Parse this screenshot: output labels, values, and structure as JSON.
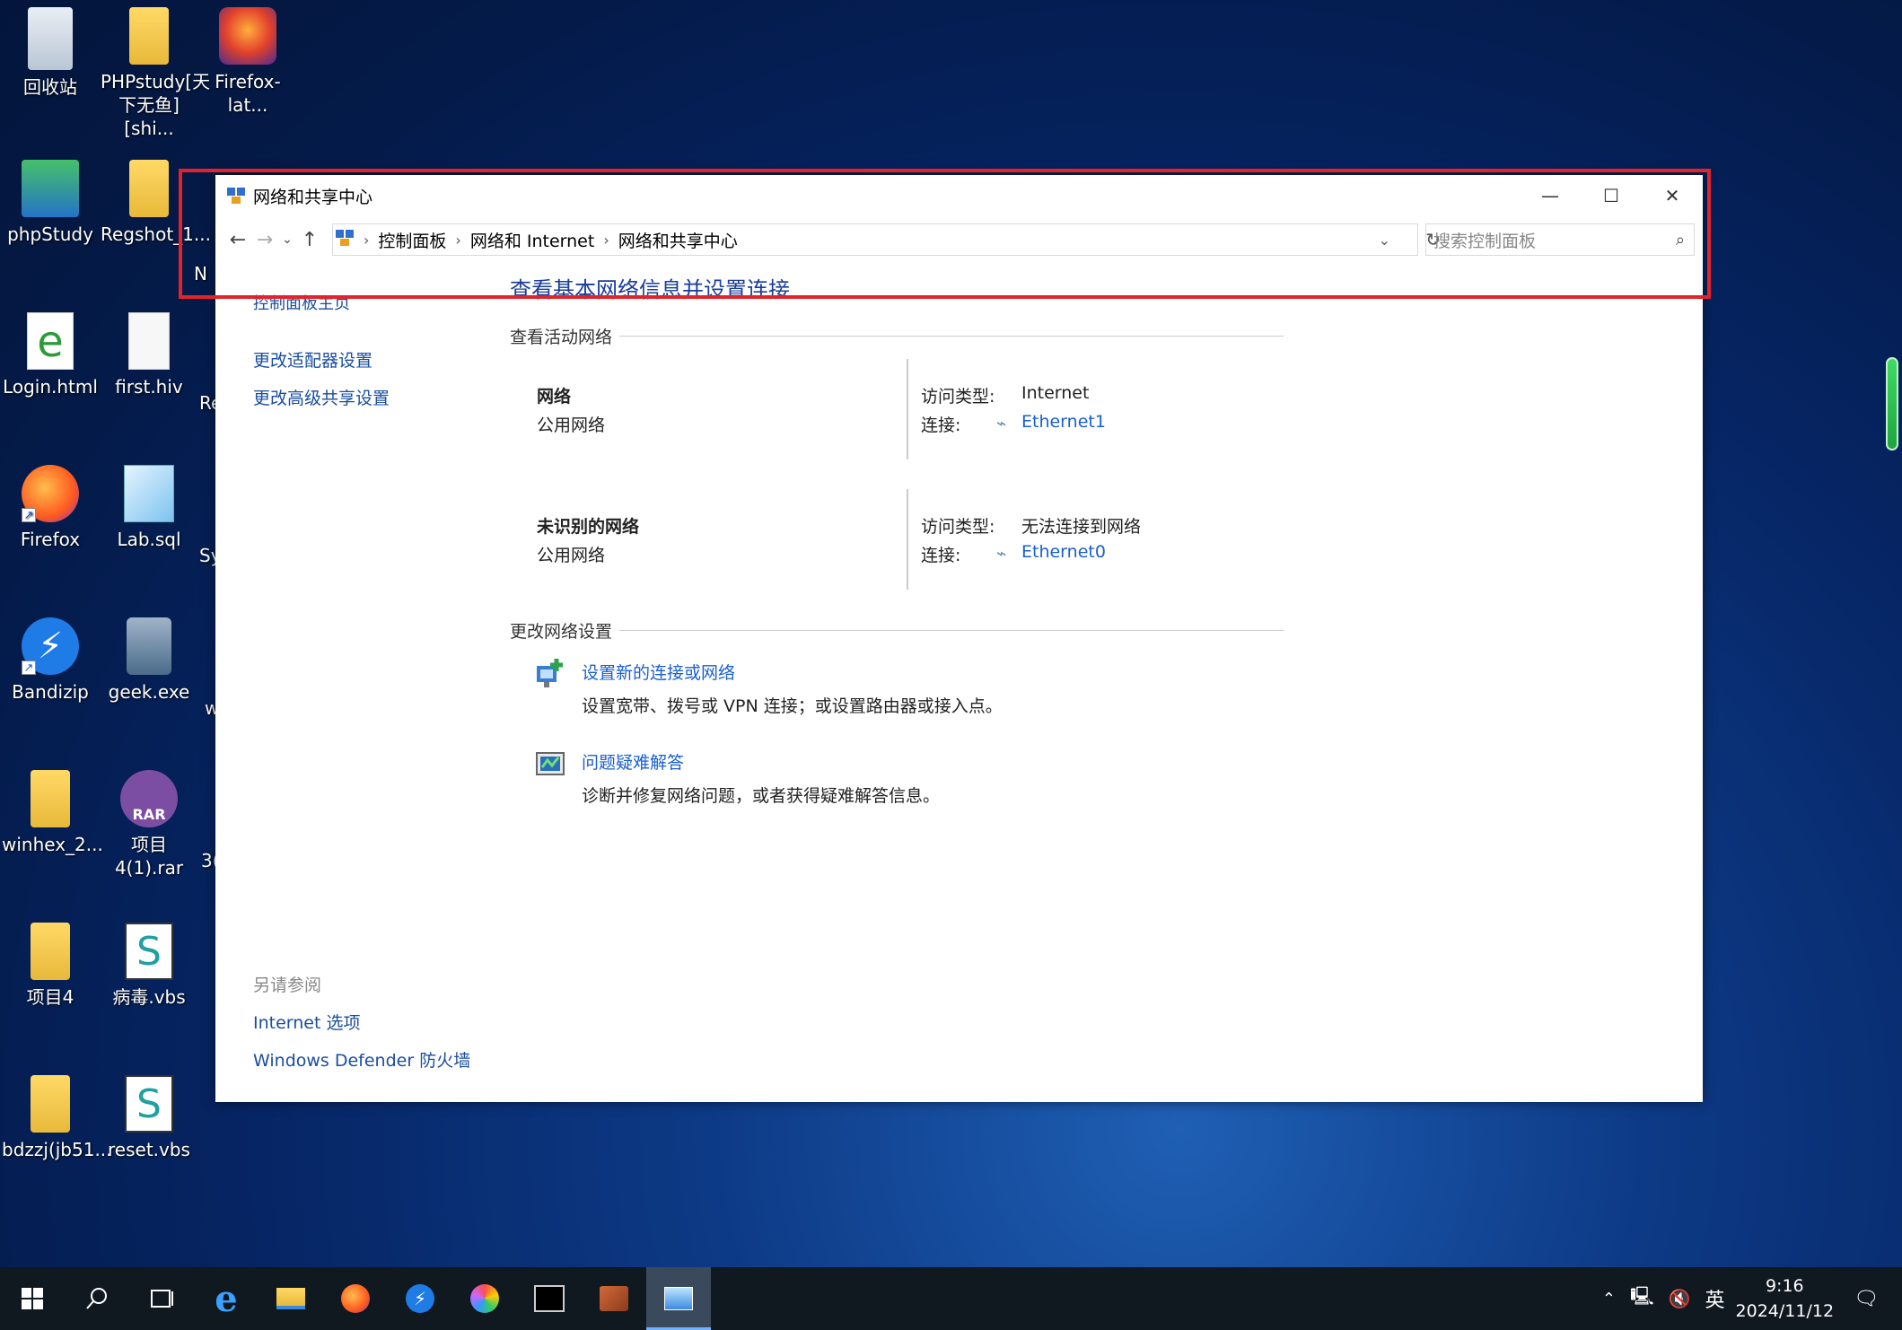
{
  "desktop": {
    "icons": [
      {
        "label": "回收站"
      },
      {
        "label": "PHPstudy[天\n下无鱼][shi..."
      },
      {
        "label": "Firefox-lat..."
      },
      {
        "label": "phpStudy"
      },
      {
        "label": "Regshot_1..."
      },
      {
        "label": "Login.html"
      },
      {
        "label": "first.hiv"
      },
      {
        "label": "Firefox"
      },
      {
        "label": "Lab.sql"
      },
      {
        "label": "Bandizip"
      },
      {
        "label": "geek.exe"
      },
      {
        "label": "winhex_2..."
      },
      {
        "label": "项目4(1).rar"
      },
      {
        "label": "项目4"
      },
      {
        "label": "病毒.vbs"
      },
      {
        "label": "bdzzj(jb51..."
      },
      {
        "label": "reset.vbs"
      }
    ],
    "partial_labels": [
      "N",
      "Re",
      "Sy",
      "w",
      "3("
    ]
  },
  "window": {
    "title": "网络和共享中心",
    "controls": {
      "minimize": "—",
      "maximize": "☐",
      "close": "✕"
    },
    "breadcrumbs": [
      "控制面板",
      "网络和 Internet",
      "网络和共享中心"
    ],
    "search_placeholder": "搜索控制面板",
    "left_nav": {
      "home": "控制面板主页",
      "adapter": "更改适配器设置",
      "sharing": "更改高级共享设置",
      "see_also_heading": "另请参阅",
      "internet_options": "Internet 选项",
      "firewall": "Windows Defender 防火墙"
    },
    "main_title": "查看基本网络信息并设置连接",
    "active_networks_heading": "查看活动网络",
    "networks": [
      {
        "name": "网络",
        "type": "公用网络",
        "access_label": "访问类型:",
        "access": "Internet",
        "conn_label": "连接:",
        "conn": "Ethernet1"
      },
      {
        "name": "未识别的网络",
        "type": "公用网络",
        "access_label": "访问类型:",
        "access": "无法连接到网络",
        "conn_label": "连接:",
        "conn": "Ethernet0"
      }
    ],
    "change_heading": "更改网络设置",
    "tasks": [
      {
        "title": "设置新的连接或网络",
        "desc": "设置宽带、拨号或 VPN 连接；或设置路由器或接入点。"
      },
      {
        "title": "问题疑难解答",
        "desc": "诊断并修复网络问题，或者获得疑难解答信息。"
      }
    ]
  },
  "taskbar": {
    "ime": "英",
    "time": "9:16",
    "date": "2024/11/12"
  },
  "colors": {
    "highlight": "#e3232c",
    "link": "#1a5fd0"
  }
}
